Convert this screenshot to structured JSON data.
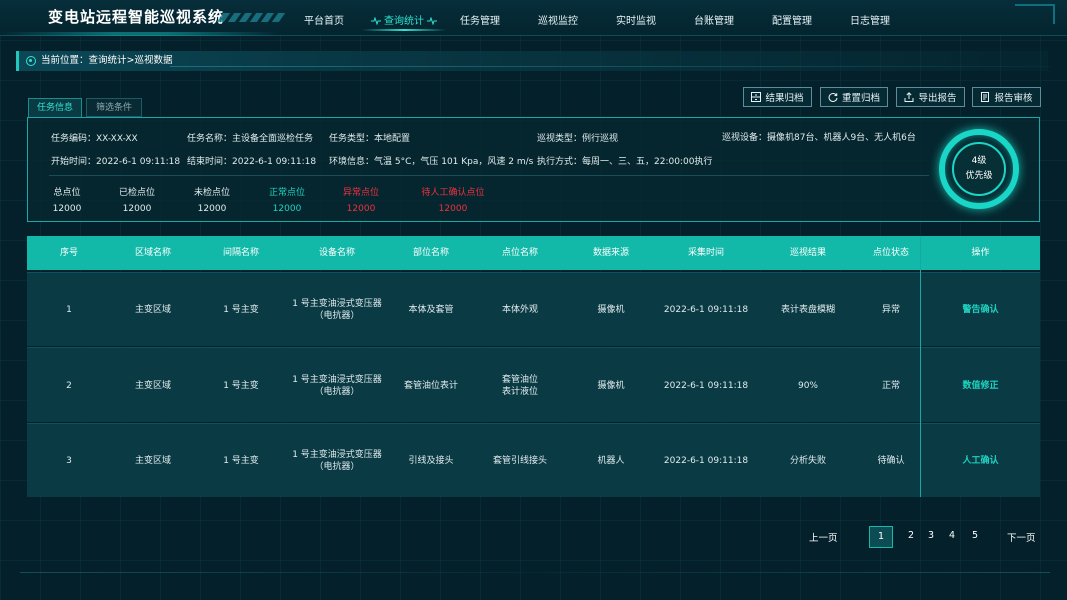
{
  "app": {
    "title": "变电站远程智能巡视系统"
  },
  "nav": {
    "items": [
      {
        "label": "平台首页"
      },
      {
        "label": "查询统计"
      },
      {
        "label": "任务管理"
      },
      {
        "label": "巡视监控"
      },
      {
        "label": "实时监视"
      },
      {
        "label": "台账管理"
      },
      {
        "label": "配置管理"
      },
      {
        "label": "日志管理"
      }
    ],
    "active_index": 1
  },
  "breadcrumb": {
    "text": "当前位置：查询统计>巡视数据"
  },
  "tabs": [
    {
      "label": "任务信息",
      "active": true
    },
    {
      "label": "筛选条件",
      "active": false
    }
  ],
  "actions": [
    {
      "label": "结果归档",
      "icon": "archive-icon"
    },
    {
      "label": "重置归档",
      "icon": "refresh-icon"
    },
    {
      "label": "导出报告",
      "icon": "export-icon"
    },
    {
      "label": "报告审核",
      "icon": "audit-icon"
    }
  ],
  "task_info": {
    "code": "任务编码：XX-XX-XX",
    "name": "任务名称：主设备全面巡检任务",
    "type": "任务类型：本地配置",
    "patrol_type": "巡视类型：例行巡视",
    "devices": "巡视设备：摄像机87台、机器人9台、无人机6台",
    "start": "开始时间：2022-6-1 09:11:18",
    "end": "结束时间：2022-6-1 09:11:18",
    "env": "环境信息：气温 5°C，气压 101 Kpa，风速 2 m/s",
    "exec": "执行方式：每周一、三、五，22:00:00执行"
  },
  "stats": [
    {
      "label": "总点位",
      "value": "12000",
      "tone": "white"
    },
    {
      "label": "已检点位",
      "value": "12000",
      "tone": "white"
    },
    {
      "label": "未检点位",
      "value": "12000",
      "tone": "white"
    },
    {
      "label": "正常点位",
      "value": "12000",
      "tone": "green"
    },
    {
      "label": "异常点位",
      "value": "12000",
      "tone": "red"
    },
    {
      "label": "待人工确认点位",
      "value": "12000",
      "tone": "red"
    }
  ],
  "priority": {
    "level": "4级",
    "label": "优先级"
  },
  "table": {
    "columns": [
      "序号",
      "区域名称",
      "间隔名称",
      "设备名称",
      "部位名称",
      "点位名称",
      "数据来源",
      "采集时间",
      "巡视结果",
      "点位状态",
      "操作"
    ],
    "rows": [
      [
        "1",
        "主变区域",
        "1 号主变",
        "1 号主变油浸式变压器\n（电抗器）",
        "本体及套管",
        "本体外观",
        "摄像机",
        "2022-6-1 09:11:18",
        "表计表盘模糊",
        "异常",
        "警告确认"
      ],
      [
        "2",
        "主变区域",
        "1 号主变",
        "1 号主变油浸式变压器\n（电抗器）",
        "套管油位表计",
        "套管油位\n表计液位",
        "摄像机",
        "2022-6-1 09:11:18",
        "90%",
        "正常",
        "数值修正"
      ],
      [
        "3",
        "主变区域",
        "1 号主变",
        "1 号主变油浸式变压器\n（电抗器）",
        "引线及接头",
        "套管引线接头",
        "机器人",
        "2022-6-1 09:11:18",
        "分析失败",
        "待确认",
        "人工确认"
      ]
    ]
  },
  "pagination": {
    "prev": "上一页",
    "next": "下一页",
    "pages": [
      "1",
      "2",
      "3",
      "4",
      "5"
    ],
    "current": "1"
  },
  "colors": {
    "accent": "#2fe3d1",
    "table_header": "#13b9a8",
    "danger": "#f03040",
    "background": "#04202a"
  }
}
